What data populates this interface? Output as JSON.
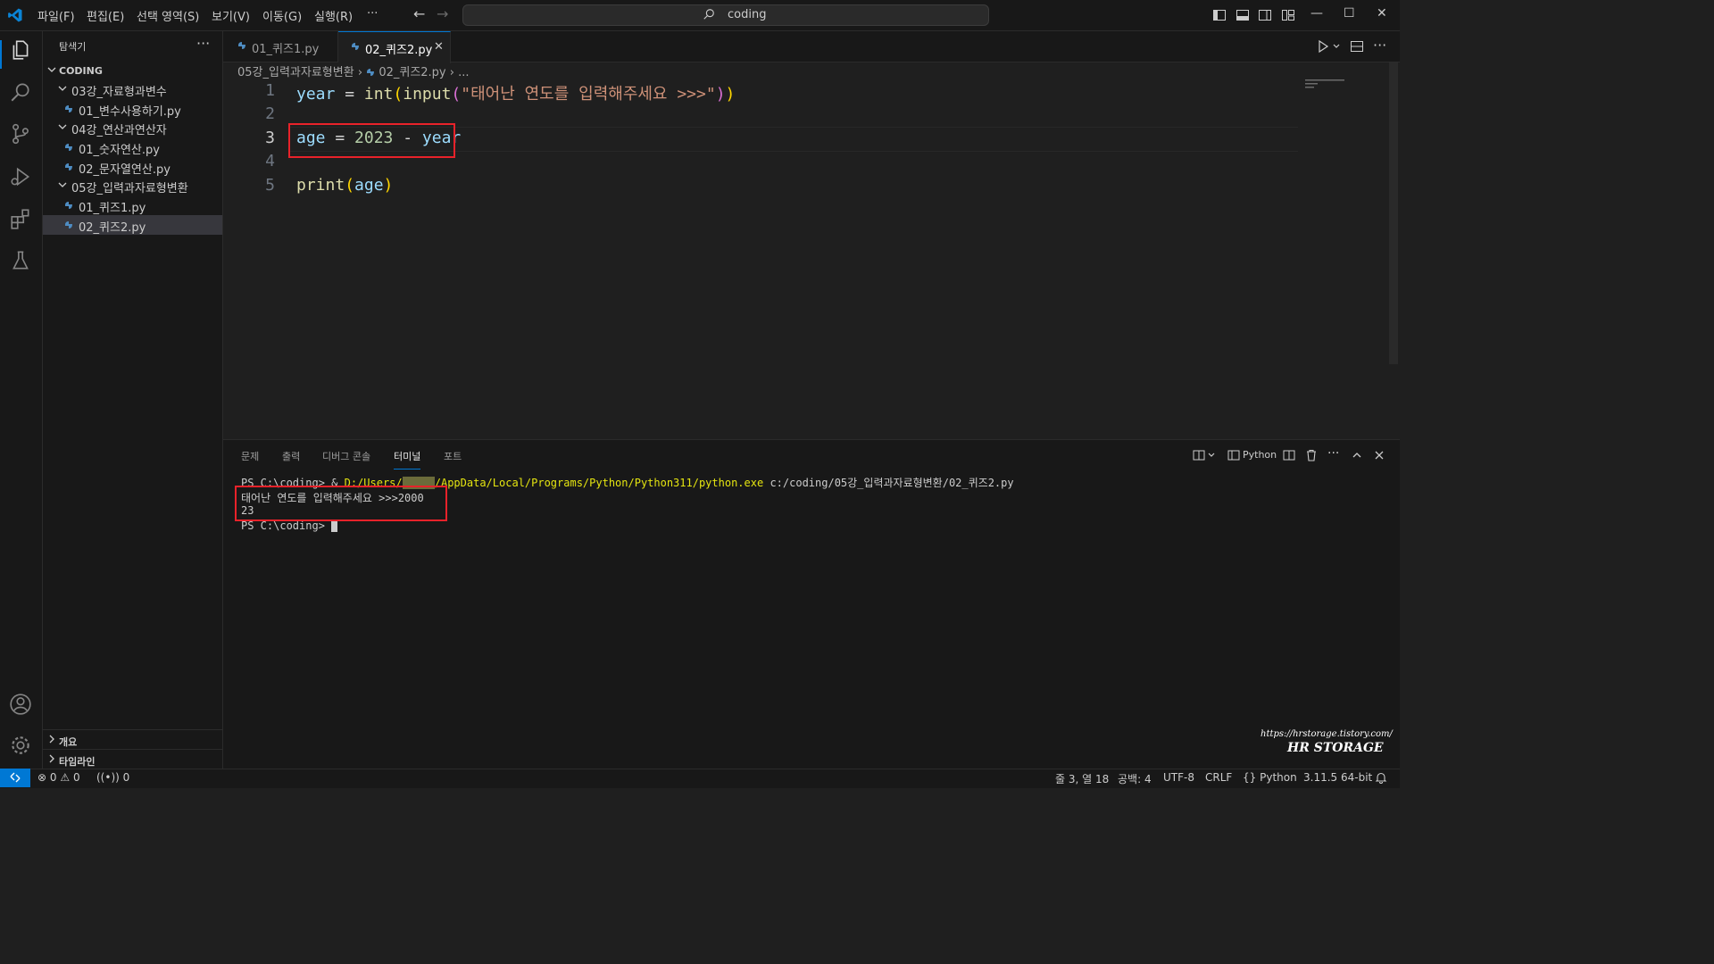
{
  "titlebar": {
    "menus": [
      "파일(F)",
      "편집(E)",
      "선택 영역(S)",
      "보기(V)",
      "이동(G)",
      "실행(R)",
      "···"
    ],
    "search": "coding"
  },
  "sidebar": {
    "title": "탐색기",
    "more": "···",
    "root": "CODING",
    "folders": [
      {
        "name": "03강_자료형과변수",
        "files": [
          "01_변수사용하기.py"
        ]
      },
      {
        "name": "04강_연산과연산자",
        "files": [
          "01_숫자연산.py",
          "02_문자열연산.py"
        ]
      },
      {
        "name": "05강_입력과자료형변환",
        "files": [
          "01_퀴즈1.py",
          "02_퀴즈2.py"
        ]
      }
    ],
    "outline": "개요",
    "timeline": "타임라인"
  },
  "editor": {
    "tabs": [
      "01_퀴즈1.py",
      "02_퀴즈2.py"
    ],
    "breadcrumb": {
      "folder": "05강_입력과자료형변환",
      "file": "02_퀴즈2.py",
      "rest": "..."
    },
    "line_numbers": [
      "1",
      "2",
      "3",
      "4",
      "5"
    ],
    "code": {
      "l1": {
        "var": "year",
        "eq": " = ",
        "fn1": "int",
        "open1": "(",
        "fn2": "input",
        "open2": "(",
        "str": "\"태어난 연도를 입력해주세요 >>>\"",
        "close2": ")",
        "close1": ")"
      },
      "l3": {
        "var": "age",
        "eq": " = ",
        "num": "2023",
        "minus": " - ",
        "var2": "year"
      },
      "l5": {
        "fn": "print",
        "open": "(",
        "arg": "age",
        "close": ")"
      }
    }
  },
  "panel": {
    "tabs": [
      "문제",
      "출력",
      "디버그 콘솔",
      "터미널",
      "포트"
    ],
    "active_tab": "터미널",
    "shell": "Python",
    "terminal": {
      "line1_prompt": "PS C:\\coding> & ",
      "line1_cmd": "D:/Users/",
      "line1_blur": "     ",
      "line1_cmd2": "/AppData/Local/Programs/Python/Python311/python.exe",
      "line1_arg": " c:/coding/05강_입력과자료형변환/02_퀴즈2.py",
      "line2": "태어난 연도를 입력해주세요 >>>2000",
      "line3": "23",
      "line4": "PS C:\\coding> "
    }
  },
  "watermark": {
    "url": "https://hrstorage.tistory.com/",
    "brand": "HR STORAGE"
  },
  "statusbar": {
    "errors": "0",
    "warnings": "0",
    "ports": "0",
    "position": "줄 3, 열 18",
    "spaces": "공백: 4",
    "encoding": "UTF-8",
    "eol": "CRLF",
    "language": "Python",
    "interpreter": "3.11.5 64-bit"
  },
  "colors": {
    "accent": "#0078d4",
    "highlight_box": "#e8222a"
  }
}
